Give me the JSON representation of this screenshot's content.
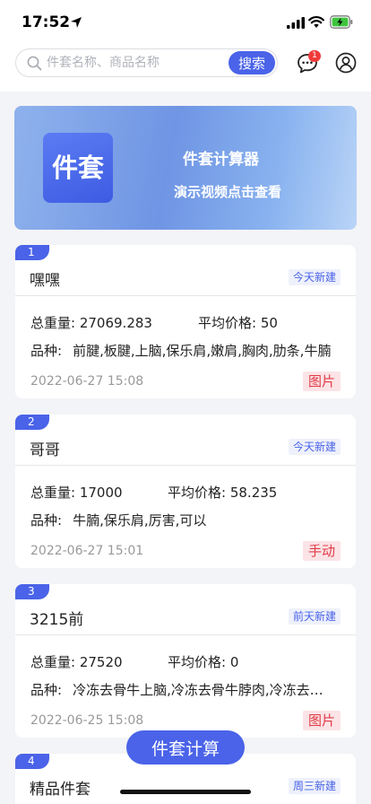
{
  "status_bar": {
    "time": "17:52"
  },
  "search": {
    "placeholder": "件套名称、商品名称",
    "button_label": "搜索"
  },
  "header": {
    "message_badge": "1"
  },
  "banner": {
    "logo_text": "件套",
    "title": "件套计算器",
    "subtitle": "演示视频点击查看"
  },
  "labels": {
    "total_weight": "总重量:",
    "avg_price": "平均价格:",
    "varieties": "品种:"
  },
  "cards": [
    {
      "index": "1",
      "name": "嘿嘿",
      "tag": "今天新建",
      "total_weight": "27069.283",
      "avg_price": "50",
      "varieties": "前腱,板腱,上脑,保乐肩,嫩肩,胸肉,肋条,牛腩",
      "time": "2022-06-27 15:08",
      "type": "图片"
    },
    {
      "index": "2",
      "name": "哥哥",
      "tag": "今天新建",
      "total_weight": "17000",
      "avg_price": "58.235",
      "varieties": "牛腩,保乐肩,厉害,可以",
      "time": "2022-06-27 15:01",
      "type": "手动"
    },
    {
      "index": "3",
      "name": "3215前",
      "tag": "前天新建",
      "total_weight": "27520",
      "avg_price": "0",
      "varieties": "冷冻去骨牛上脑,冷冻去骨牛脖肉,冷冻去骨牛腱",
      "time": "2022-06-25 15:08",
      "type": "图片"
    },
    {
      "index": "4",
      "name": "精品件套",
      "tag": "周三新建"
    }
  ],
  "fab_label": "件套计算",
  "colors": {
    "accent": "#4a63e8",
    "type_badge_text": "#e23b46",
    "type_badge_bg": "#fbe3e6",
    "tag_bg": "#eef1fb"
  },
  "icons": [
    "location-arrow-icon",
    "signal-icon",
    "wifi-icon",
    "battery-charging-icon",
    "search-icon",
    "message-icon",
    "user-icon"
  ]
}
